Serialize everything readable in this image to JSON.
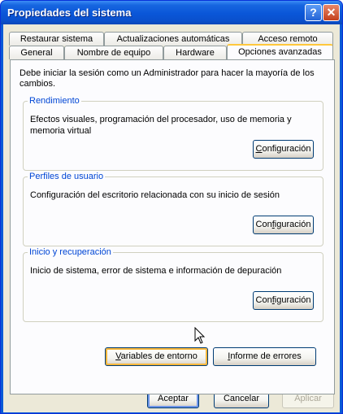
{
  "window": {
    "title": "Propiedades del sistema",
    "help_glyph": "?",
    "close_glyph": "✕"
  },
  "tabs_row1": [
    {
      "label": "Restaurar sistema"
    },
    {
      "label": "Actualizaciones automáticas"
    },
    {
      "label": "Acceso remoto"
    }
  ],
  "tabs_row2": [
    {
      "label": "General"
    },
    {
      "label": "Nombre de equipo"
    },
    {
      "label": "Hardware"
    },
    {
      "label": "Opciones avanzadas",
      "active": true
    }
  ],
  "panel": {
    "intro": "Debe iniciar la sesión como un Administrador para hacer la mayoría de los cambios.",
    "performance": {
      "legend": "Rendimiento",
      "text": "Efectos visuales, programación del procesador, uso de memoria y memoria virtual",
      "button_pre": "",
      "button_key": "C",
      "button_post": "onfiguración"
    },
    "profiles": {
      "legend": "Perfiles de usuario",
      "text": "Configuración del escritorio relacionada con su inicio de sesión",
      "button_pre": "Con",
      "button_key": "f",
      "button_post": "iguración"
    },
    "startup": {
      "legend": "Inicio y recuperación",
      "text": "Inicio de sistema, error de sistema e información de depuración",
      "button_pre": "Con",
      "button_key": "f",
      "button_post": "iguración"
    },
    "env_button": {
      "pre": "",
      "key": "V",
      "post": "ariables de entorno"
    },
    "error_button": {
      "pre": "",
      "key": "I",
      "post": "nforme de errores"
    }
  },
  "footer": {
    "ok": "Aceptar",
    "cancel": "Cancelar",
    "apply": "Aplicar"
  },
  "colors": {
    "titlebar": "#0a56d8",
    "dialog_bg": "#ece9d8",
    "legend_text": "#0046d5",
    "active_tab_accent": "#ffc83c"
  }
}
